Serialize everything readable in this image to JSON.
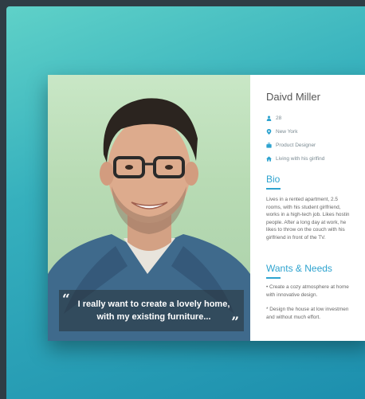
{
  "persona": {
    "name": "Daivd Miller",
    "facts": [
      {
        "icon": "person-icon",
        "text": "28"
      },
      {
        "icon": "location-pin-icon",
        "text": "New York"
      },
      {
        "icon": "briefcase-icon",
        "text": "Product Designer"
      },
      {
        "icon": "home-icon",
        "text": "Living with his girlfind"
      }
    ],
    "quote": "I really want to create a lovely home,\nwith my existing furniture...",
    "bio_heading": "Bio",
    "bio_text": "Lives in a rented apartment, 2.5\nrooms, with his student girlfriend,\nworks in a high-tech job. Likes hostin\npeople. After a long day at work, he\nlikes to throw on the couch with his\ngirlfriend in front of the TV.",
    "needs_heading": "Wants & Needs",
    "needs": [
      "• Create a cozy atmosphere at home\n   with innovative design.",
      "* Design the house at low investmen\n   and without much effort."
    ]
  },
  "colors": {
    "accent": "#2ea3cf",
    "background_teal": "#36b0bd"
  }
}
